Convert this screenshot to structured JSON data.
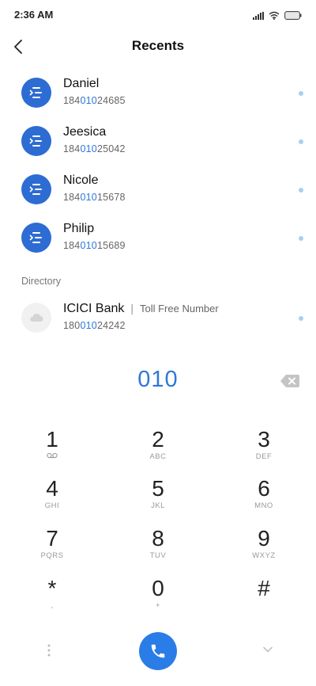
{
  "status_bar": {
    "time": "2:36 AM",
    "icons": [
      "signal-icon",
      "wifi-icon",
      "battery-icon"
    ]
  },
  "header": {
    "title": "Recents"
  },
  "recents": [
    {
      "name": "Daniel",
      "number_pre": "184",
      "number_match": "010",
      "number_post": "24685"
    },
    {
      "name": "Jeesica",
      "number_pre": "184",
      "number_match": "010",
      "number_post": "25042"
    },
    {
      "name": "Nicole",
      "number_pre": "184",
      "number_match": "010",
      "number_post": "15678"
    },
    {
      "name": "Philip",
      "number_pre": "184",
      "number_match": "010",
      "number_post": "15689"
    }
  ],
  "directory": {
    "label": "Directory",
    "items": [
      {
        "name": "ICICI Bank",
        "tag": "Toll Free Number",
        "number_pre": "180",
        "number_match": "010",
        "number_post": "24242"
      }
    ]
  },
  "dialer": {
    "input": "010",
    "keys": [
      {
        "digit": "1",
        "sub": ""
      },
      {
        "digit": "2",
        "sub": "ABC"
      },
      {
        "digit": "3",
        "sub": "DEF"
      },
      {
        "digit": "4",
        "sub": "GHI"
      },
      {
        "digit": "5",
        "sub": "JKL"
      },
      {
        "digit": "6",
        "sub": "MNO"
      },
      {
        "digit": "7",
        "sub": "PQRS"
      },
      {
        "digit": "8",
        "sub": "TUV"
      },
      {
        "digit": "9",
        "sub": "WXYZ"
      },
      {
        "digit": "*",
        "sub": ","
      },
      {
        "digit": "0",
        "sub": "+"
      },
      {
        "digit": "#",
        "sub": ""
      }
    ]
  },
  "colors": {
    "accent": "#2d78d6",
    "avatar": "#2d6cd3",
    "call_button": "#2a7de6",
    "dot": "#a9cff2"
  }
}
